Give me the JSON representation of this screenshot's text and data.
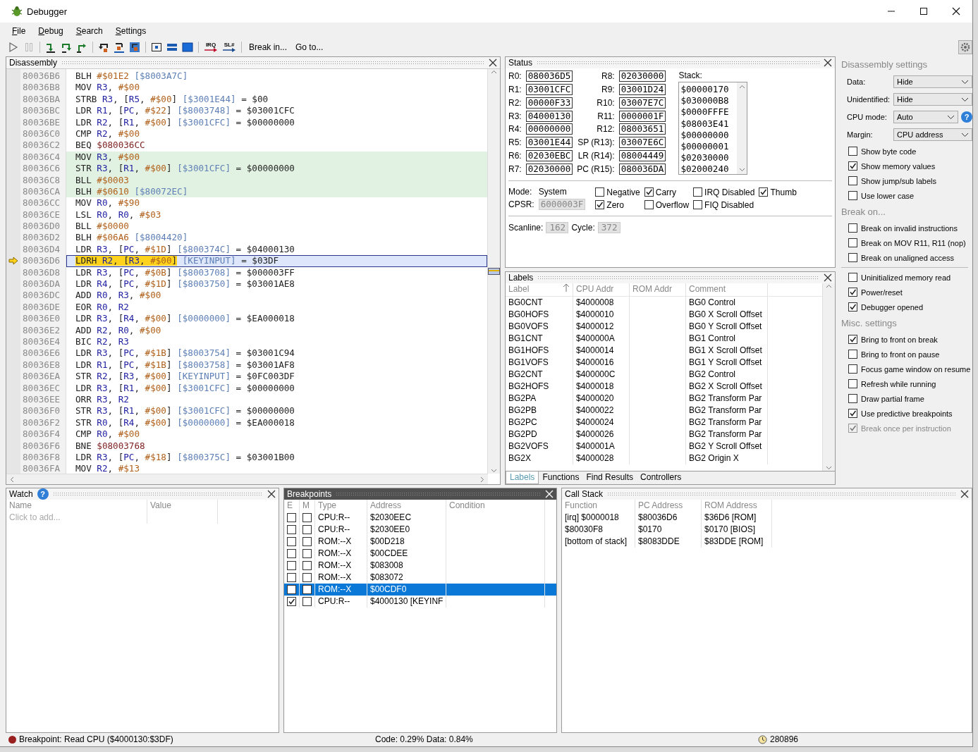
{
  "window": {
    "title": "Debugger"
  },
  "menu": [
    "File",
    "Debug",
    "Search",
    "Settings"
  ],
  "toolbar": {
    "pause_enabled": false,
    "irq_label": "IRQ",
    "scanline_label": "SL#",
    "buttons": [
      "Break in...",
      "Go to..."
    ]
  },
  "disassembly": {
    "title": "Disassembly",
    "rows": [
      {
        "address": "80036B6",
        "kind": "normal",
        "code": [
          {
            "kind": "op",
            "text": "BLH "
          },
          {
            "kind": "imm",
            "text": "#$01E2"
          }
        ],
        "note": [
          {
            "kind": "ref",
            "text": "[$8003A7C]"
          }
        ]
      },
      {
        "address": "80036B8",
        "kind": "normal",
        "code": [
          {
            "kind": "op",
            "text": "MOV "
          },
          {
            "kind": "reg",
            "text": "R3"
          },
          {
            "kind": "plain",
            "text": ", "
          },
          {
            "kind": "imm",
            "text": "#$00"
          }
        ]
      },
      {
        "address": "80036BA",
        "kind": "normal",
        "code": [
          {
            "kind": "op",
            "text": "STRB "
          },
          {
            "kind": "reg",
            "text": "R3"
          },
          {
            "kind": "plain",
            "text": ", ["
          },
          {
            "kind": "reg",
            "text": "R5"
          },
          {
            "kind": "plain",
            "text": ", "
          },
          {
            "kind": "imm",
            "text": "#$00"
          },
          {
            "kind": "plain",
            "text": "]"
          }
        ],
        "note": [
          {
            "kind": "ref",
            "text": "[$3001E44]"
          },
          {
            "kind": "plain",
            "text": " = $00"
          }
        ]
      },
      {
        "address": "80036BC",
        "kind": "normal",
        "code": [
          {
            "kind": "op",
            "text": "LDR "
          },
          {
            "kind": "reg",
            "text": "R1"
          },
          {
            "kind": "plain",
            "text": ", ["
          },
          {
            "kind": "reg",
            "text": "PC"
          },
          {
            "kind": "plain",
            "text": ", "
          },
          {
            "kind": "imm",
            "text": "#$22"
          },
          {
            "kind": "plain",
            "text": "]"
          }
        ],
        "note": [
          {
            "kind": "ref",
            "text": "[$8003748]"
          },
          {
            "kind": "plain",
            "text": " = $03001CFC"
          }
        ]
      },
      {
        "address": "80036BE",
        "kind": "normal",
        "code": [
          {
            "kind": "op",
            "text": "LDR "
          },
          {
            "kind": "reg",
            "text": "R2"
          },
          {
            "kind": "plain",
            "text": ", ["
          },
          {
            "kind": "reg",
            "text": "R1"
          },
          {
            "kind": "plain",
            "text": ", "
          },
          {
            "kind": "imm",
            "text": "#$00"
          },
          {
            "kind": "plain",
            "text": "]"
          }
        ],
        "note": [
          {
            "kind": "ref",
            "text": "[$3001CFC]"
          },
          {
            "kind": "plain",
            "text": " = $00000000"
          }
        ]
      },
      {
        "address": "80036C0",
        "kind": "normal",
        "code": [
          {
            "kind": "op",
            "text": "CMP "
          },
          {
            "kind": "reg",
            "text": "R2"
          },
          {
            "kind": "plain",
            "text": ", "
          },
          {
            "kind": "imm",
            "text": "#$00"
          }
        ]
      },
      {
        "address": "80036C2",
        "kind": "normal",
        "code": [
          {
            "kind": "op",
            "text": "BEQ "
          },
          {
            "kind": "target",
            "text": "$080036CC"
          }
        ]
      },
      {
        "address": "80036C4",
        "kind": "block",
        "code": [
          {
            "kind": "op",
            "text": "MOV "
          },
          {
            "kind": "reg",
            "text": "R3"
          },
          {
            "kind": "plain",
            "text": ", "
          },
          {
            "kind": "imm",
            "text": "#$00"
          }
        ]
      },
      {
        "address": "80036C6",
        "kind": "block",
        "code": [
          {
            "kind": "op",
            "text": "STR "
          },
          {
            "kind": "reg",
            "text": "R3"
          },
          {
            "kind": "plain",
            "text": ", ["
          },
          {
            "kind": "reg",
            "text": "R1"
          },
          {
            "kind": "plain",
            "text": ", "
          },
          {
            "kind": "imm",
            "text": "#$00"
          },
          {
            "kind": "plain",
            "text": "]"
          }
        ],
        "note": [
          {
            "kind": "ref",
            "text": "[$3001CFC]"
          },
          {
            "kind": "plain",
            "text": " = $00000000"
          }
        ]
      },
      {
        "address": "80036C8",
        "kind": "block",
        "code": [
          {
            "kind": "op",
            "text": "BLL "
          },
          {
            "kind": "imm",
            "text": "#$0003"
          }
        ]
      },
      {
        "address": "80036CA",
        "kind": "block",
        "code": [
          {
            "kind": "op",
            "text": "BLH "
          },
          {
            "kind": "imm",
            "text": "#$0610"
          }
        ],
        "note": [
          {
            "kind": "ref",
            "text": "[$80072EC]"
          }
        ]
      },
      {
        "address": "80036CC",
        "kind": "normal",
        "code": [
          {
            "kind": "op",
            "text": "MOV "
          },
          {
            "kind": "reg",
            "text": "R0"
          },
          {
            "kind": "plain",
            "text": ", "
          },
          {
            "kind": "imm",
            "text": "#$90"
          }
        ]
      },
      {
        "address": "80036CE",
        "kind": "normal",
        "code": [
          {
            "kind": "op",
            "text": "LSL "
          },
          {
            "kind": "reg",
            "text": "R0"
          },
          {
            "kind": "plain",
            "text": ", "
          },
          {
            "kind": "reg",
            "text": "R0"
          },
          {
            "kind": "plain",
            "text": ", "
          },
          {
            "kind": "imm",
            "text": "#$03"
          }
        ]
      },
      {
        "address": "80036D0",
        "kind": "normal",
        "code": [
          {
            "kind": "op",
            "text": "BLL "
          },
          {
            "kind": "imm",
            "text": "#$0000"
          }
        ]
      },
      {
        "address": "80036D2",
        "kind": "normal",
        "code": [
          {
            "kind": "op",
            "text": "BLH "
          },
          {
            "kind": "imm",
            "text": "#$06A6"
          }
        ],
        "note": [
          {
            "kind": "ref",
            "text": "[$8004420]"
          }
        ]
      },
      {
        "address": "80036D4",
        "kind": "normal",
        "code": [
          {
            "kind": "op",
            "text": "LDR "
          },
          {
            "kind": "reg",
            "text": "R3"
          },
          {
            "kind": "plain",
            "text": ", ["
          },
          {
            "kind": "reg",
            "text": "PC"
          },
          {
            "kind": "plain",
            "text": ", "
          },
          {
            "kind": "imm",
            "text": "#$1D"
          },
          {
            "kind": "plain",
            "text": "]"
          }
        ],
        "note": [
          {
            "kind": "ref",
            "text": "[$800374C]"
          },
          {
            "kind": "plain",
            "text": " = $04000130"
          }
        ]
      },
      {
        "address": "80036D6",
        "kind": "current",
        "code": [
          {
            "kind": "op",
            "text": "LDRH "
          },
          {
            "kind": "reg",
            "text": "R2"
          },
          {
            "kind": "plain",
            "text": ", ["
          },
          {
            "kind": "reg",
            "text": "R3"
          },
          {
            "kind": "plain",
            "text": ", "
          },
          {
            "kind": "imm",
            "text": "#$00"
          },
          {
            "kind": "plain",
            "text": "]"
          }
        ],
        "note": [
          {
            "kind": "ref",
            "text": "[KEYINPUT]"
          },
          {
            "kind": "plain",
            "text": " = $03DF"
          }
        ]
      },
      {
        "address": "80036D8",
        "kind": "normal",
        "code": [
          {
            "kind": "op",
            "text": "LDR "
          },
          {
            "kind": "reg",
            "text": "R3"
          },
          {
            "kind": "plain",
            "text": ", ["
          },
          {
            "kind": "reg",
            "text": "PC"
          },
          {
            "kind": "plain",
            "text": ", "
          },
          {
            "kind": "imm",
            "text": "#$0B"
          },
          {
            "kind": "plain",
            "text": "]"
          }
        ],
        "note": [
          {
            "kind": "ref",
            "text": "[$8003708]"
          },
          {
            "kind": "plain",
            "text": " = $000003FF"
          }
        ]
      },
      {
        "address": "80036DA",
        "kind": "normal",
        "code": [
          {
            "kind": "op",
            "text": "LDR "
          },
          {
            "kind": "reg",
            "text": "R4"
          },
          {
            "kind": "plain",
            "text": ", ["
          },
          {
            "kind": "reg",
            "text": "PC"
          },
          {
            "kind": "plain",
            "text": ", "
          },
          {
            "kind": "imm",
            "text": "#$1D"
          },
          {
            "kind": "plain",
            "text": "]"
          }
        ],
        "note": [
          {
            "kind": "ref",
            "text": "[$8003750]"
          },
          {
            "kind": "plain",
            "text": " = $03001AE8"
          }
        ]
      },
      {
        "address": "80036DC",
        "kind": "normal",
        "code": [
          {
            "kind": "op",
            "text": "ADD "
          },
          {
            "kind": "reg",
            "text": "R0"
          },
          {
            "kind": "plain",
            "text": ", "
          },
          {
            "kind": "reg",
            "text": "R3"
          },
          {
            "kind": "plain",
            "text": ", "
          },
          {
            "kind": "imm",
            "text": "#$00"
          }
        ]
      },
      {
        "address": "80036DE",
        "kind": "normal",
        "code": [
          {
            "kind": "op",
            "text": "EOR "
          },
          {
            "kind": "reg",
            "text": "R0"
          },
          {
            "kind": "plain",
            "text": ", "
          },
          {
            "kind": "reg",
            "text": "R2"
          }
        ]
      },
      {
        "address": "80036E0",
        "kind": "normal",
        "code": [
          {
            "kind": "op",
            "text": "LDR "
          },
          {
            "kind": "reg",
            "text": "R3"
          },
          {
            "kind": "plain",
            "text": ", ["
          },
          {
            "kind": "reg",
            "text": "R4"
          },
          {
            "kind": "plain",
            "text": ", "
          },
          {
            "kind": "imm",
            "text": "#$00"
          },
          {
            "kind": "plain",
            "text": "]"
          }
        ],
        "note": [
          {
            "kind": "ref",
            "text": "[$0000000]"
          },
          {
            "kind": "plain",
            "text": " = $EA000018"
          }
        ]
      },
      {
        "address": "80036E2",
        "kind": "normal",
        "code": [
          {
            "kind": "op",
            "text": "ADD "
          },
          {
            "kind": "reg",
            "text": "R2"
          },
          {
            "kind": "plain",
            "text": ", "
          },
          {
            "kind": "reg",
            "text": "R0"
          },
          {
            "kind": "plain",
            "text": ", "
          },
          {
            "kind": "imm",
            "text": "#$00"
          }
        ]
      },
      {
        "address": "80036E4",
        "kind": "normal",
        "code": [
          {
            "kind": "op",
            "text": "BIC "
          },
          {
            "kind": "reg",
            "text": "R2"
          },
          {
            "kind": "plain",
            "text": ", "
          },
          {
            "kind": "reg",
            "text": "R3"
          }
        ]
      },
      {
        "address": "80036E6",
        "kind": "normal",
        "code": [
          {
            "kind": "op",
            "text": "LDR "
          },
          {
            "kind": "reg",
            "text": "R3"
          },
          {
            "kind": "plain",
            "text": ", ["
          },
          {
            "kind": "reg",
            "text": "PC"
          },
          {
            "kind": "plain",
            "text": ", "
          },
          {
            "kind": "imm",
            "text": "#$1B"
          },
          {
            "kind": "plain",
            "text": "]"
          }
        ],
        "note": [
          {
            "kind": "ref",
            "text": "[$8003754]"
          },
          {
            "kind": "plain",
            "text": " = $03001C94"
          }
        ]
      },
      {
        "address": "80036E8",
        "kind": "normal",
        "code": [
          {
            "kind": "op",
            "text": "LDR "
          },
          {
            "kind": "reg",
            "text": "R1"
          },
          {
            "kind": "plain",
            "text": ", ["
          },
          {
            "kind": "reg",
            "text": "PC"
          },
          {
            "kind": "plain",
            "text": ", "
          },
          {
            "kind": "imm",
            "text": "#$1B"
          },
          {
            "kind": "plain",
            "text": "]"
          }
        ],
        "note": [
          {
            "kind": "ref",
            "text": "[$8003758]"
          },
          {
            "kind": "plain",
            "text": " = $03001AF8"
          }
        ]
      },
      {
        "address": "80036EA",
        "kind": "normal",
        "code": [
          {
            "kind": "op",
            "text": "STR "
          },
          {
            "kind": "reg",
            "text": "R2"
          },
          {
            "kind": "plain",
            "text": ", ["
          },
          {
            "kind": "reg",
            "text": "R3"
          },
          {
            "kind": "plain",
            "text": ", "
          },
          {
            "kind": "imm",
            "text": "#$00"
          },
          {
            "kind": "plain",
            "text": "]"
          }
        ],
        "note": [
          {
            "kind": "ref",
            "text": "[KEYINPUT]"
          },
          {
            "kind": "plain",
            "text": " = $0FC003DF"
          }
        ]
      },
      {
        "address": "80036EC",
        "kind": "normal",
        "code": [
          {
            "kind": "op",
            "text": "LDR "
          },
          {
            "kind": "reg",
            "text": "R3"
          },
          {
            "kind": "plain",
            "text": ", ["
          },
          {
            "kind": "reg",
            "text": "R1"
          },
          {
            "kind": "plain",
            "text": ", "
          },
          {
            "kind": "imm",
            "text": "#$00"
          },
          {
            "kind": "plain",
            "text": "]"
          }
        ],
        "note": [
          {
            "kind": "ref",
            "text": "[$3001CFC]"
          },
          {
            "kind": "plain",
            "text": " = $00000000"
          }
        ]
      },
      {
        "address": "80036EE",
        "kind": "normal",
        "code": [
          {
            "kind": "op",
            "text": "ORR "
          },
          {
            "kind": "reg",
            "text": "R3"
          },
          {
            "kind": "plain",
            "text": ", "
          },
          {
            "kind": "reg",
            "text": "R2"
          }
        ]
      },
      {
        "address": "80036F0",
        "kind": "normal",
        "code": [
          {
            "kind": "op",
            "text": "STR "
          },
          {
            "kind": "reg",
            "text": "R3"
          },
          {
            "kind": "plain",
            "text": ", ["
          },
          {
            "kind": "reg",
            "text": "R1"
          },
          {
            "kind": "plain",
            "text": ", "
          },
          {
            "kind": "imm",
            "text": "#$00"
          },
          {
            "kind": "plain",
            "text": "]"
          }
        ],
        "note": [
          {
            "kind": "ref",
            "text": "[$3001CFC]"
          },
          {
            "kind": "plain",
            "text": " = $00000000"
          }
        ]
      },
      {
        "address": "80036F2",
        "kind": "normal",
        "code": [
          {
            "kind": "op",
            "text": "STR "
          },
          {
            "kind": "reg",
            "text": "R0"
          },
          {
            "kind": "plain",
            "text": ", ["
          },
          {
            "kind": "reg",
            "text": "R4"
          },
          {
            "kind": "plain",
            "text": ", "
          },
          {
            "kind": "imm",
            "text": "#$00"
          },
          {
            "kind": "plain",
            "text": "]"
          }
        ],
        "note": [
          {
            "kind": "ref",
            "text": "[$0000000]"
          },
          {
            "kind": "plain",
            "text": " = $EA000018"
          }
        ]
      },
      {
        "address": "80036F4",
        "kind": "normal",
        "code": [
          {
            "kind": "op",
            "text": "CMP "
          },
          {
            "kind": "reg",
            "text": "R0"
          },
          {
            "kind": "plain",
            "text": ", "
          },
          {
            "kind": "imm",
            "text": "#$00"
          }
        ]
      },
      {
        "address": "80036F6",
        "kind": "normal",
        "code": [
          {
            "kind": "op",
            "text": "BNE "
          },
          {
            "kind": "target",
            "text": "$08003768"
          }
        ]
      },
      {
        "address": "80036F8",
        "kind": "normal",
        "code": [
          {
            "kind": "op",
            "text": "LDR "
          },
          {
            "kind": "reg",
            "text": "R3"
          },
          {
            "kind": "plain",
            "text": ", ["
          },
          {
            "kind": "reg",
            "text": "PC"
          },
          {
            "kind": "plain",
            "text": ", "
          },
          {
            "kind": "imm",
            "text": "#$18"
          },
          {
            "kind": "plain",
            "text": "]"
          }
        ],
        "note": [
          {
            "kind": "ref",
            "text": "[$800375C]"
          },
          {
            "kind": "plain",
            "text": " = $03001B00"
          }
        ]
      },
      {
        "address": "80036FA",
        "kind": "normal",
        "code": [
          {
            "kind": "op",
            "text": "MOV "
          },
          {
            "kind": "reg",
            "text": "R2"
          },
          {
            "kind": "plain",
            "text": ", "
          },
          {
            "kind": "imm",
            "text": "#$13"
          }
        ]
      }
    ]
  },
  "status": {
    "title": "Status",
    "registers": [
      {
        "name": "R0:",
        "value": "080036D5"
      },
      {
        "name": "R8:",
        "value": "02030000"
      },
      {
        "name": "R1:",
        "value": "03001CFC"
      },
      {
        "name": "R9:",
        "value": "03001D24"
      },
      {
        "name": "R2:",
        "value": "00000F33"
      },
      {
        "name": "R10:",
        "value": "03007E7C"
      },
      {
        "name": "R3:",
        "value": "04000130"
      },
      {
        "name": "R11:",
        "value": "0000001F"
      },
      {
        "name": "R4:",
        "value": "00000000"
      },
      {
        "name": "R12:",
        "value": "08003651"
      },
      {
        "name": "R5:",
        "value": "03001E44"
      },
      {
        "name": "SP (R13):",
        "value": "03007E6C"
      },
      {
        "name": "R6:",
        "value": "02030EBC"
      },
      {
        "name": "LR (R14):",
        "value": "08004449"
      },
      {
        "name": "R7:",
        "value": "02030000"
      },
      {
        "name": "PC (R15):",
        "value": "080036DA"
      }
    ],
    "stack_label": "Stack:",
    "stack": [
      "$00000170",
      "$030000B8",
      "$0000FFFE",
      "$08003E41",
      "$00000000",
      "$00000001",
      "$02030000",
      "$02000240"
    ],
    "mode_label": "Mode:",
    "mode": "System",
    "cpsr_label": "CPSR:",
    "cpsr": "6000003F",
    "flags": [
      {
        "label": "Negative",
        "checked": false
      },
      {
        "label": "Carry",
        "checked": true
      },
      {
        "label": "IRQ Disabled",
        "checked": false
      },
      {
        "label": "Thumb",
        "checked": true
      },
      {
        "label": "Zero",
        "checked": true
      },
      {
        "label": "Overflow",
        "checked": false
      },
      {
        "label": "FIQ Disabled",
        "checked": false
      }
    ],
    "scanline_label": "Scanline:",
    "scanline": "162",
    "cycle_label": "Cycle:",
    "cycle": "372"
  },
  "labels": {
    "title": "Labels",
    "columns": [
      {
        "label": "Label",
        "sorted": true
      },
      {
        "label": "CPU Addr",
        "sorted": false
      },
      {
        "label": "ROM Addr",
        "sorted": false
      },
      {
        "label": "Comment",
        "sorted": false
      }
    ],
    "rows": [
      {
        "label": "BG0CNT",
        "cpu_addr": "$4000008",
        "comment": "BG0 Control"
      },
      {
        "label": "BG0HOFS",
        "cpu_addr": "$4000010",
        "comment": "BG0 X Scroll Offset"
      },
      {
        "label": "BG0VOFS",
        "cpu_addr": "$4000012",
        "comment": "BG0 Y Scroll Offset"
      },
      {
        "label": "BG1CNT",
        "cpu_addr": "$400000A",
        "comment": "BG1 Control"
      },
      {
        "label": "BG1HOFS",
        "cpu_addr": "$4000014",
        "comment": "BG1 X Scroll Offset"
      },
      {
        "label": "BG1VOFS",
        "cpu_addr": "$4000016",
        "comment": "BG1 Y Scroll Offset"
      },
      {
        "label": "BG2CNT",
        "cpu_addr": "$400000C",
        "comment": "BG2 Control"
      },
      {
        "label": "BG2HOFS",
        "cpu_addr": "$4000018",
        "comment": "BG2 X Scroll Offset"
      },
      {
        "label": "BG2PA",
        "cpu_addr": "$4000020",
        "comment": "BG2 Transform Par"
      },
      {
        "label": "BG2PB",
        "cpu_addr": "$4000022",
        "comment": "BG2 Transform Par"
      },
      {
        "label": "BG2PC",
        "cpu_addr": "$4000024",
        "comment": "BG2 Transform Par"
      },
      {
        "label": "BG2PD",
        "cpu_addr": "$4000026",
        "comment": "BG2 Transform Par"
      },
      {
        "label": "BG2VOFS",
        "cpu_addr": "$400001A",
        "comment": "BG2 Y Scroll Offset"
      },
      {
        "label": "BG2X",
        "cpu_addr": "$4000028",
        "comment": "BG2 Origin X"
      }
    ],
    "tabs": [
      {
        "label": "Labels",
        "selected": true
      },
      {
        "label": "Functions",
        "selected": false
      },
      {
        "label": "Find Results",
        "selected": false
      },
      {
        "label": "Controllers",
        "selected": false
      }
    ]
  },
  "settings": {
    "title": "Disassembly settings",
    "fields": [
      {
        "label": "Data:",
        "value": "Hide"
      },
      {
        "label": "Unidentified:",
        "value": "Hide"
      },
      {
        "label": "CPU mode:",
        "value": "Auto",
        "help": "?"
      },
      {
        "label": "Margin:",
        "value": "CPU address"
      }
    ],
    "options": [
      {
        "label": "Show byte code",
        "checked": false
      },
      {
        "label": "Show memory values",
        "checked": true
      },
      {
        "label": "Show jump/sub labels",
        "checked": false
      },
      {
        "label": "Use lower case",
        "checked": false
      }
    ],
    "break_title": "Break on...",
    "break_options": [
      {
        "label": "Break on invalid instructions",
        "checked": false
      },
      {
        "label": "Break on MOV R11, R11 (nop)",
        "checked": false
      },
      {
        "label": "Break on unaligned access",
        "checked": false
      }
    ],
    "break_events": [
      {
        "label": "Uninitialized memory read",
        "checked": false
      },
      {
        "label": "Power/reset",
        "checked": true
      },
      {
        "label": "Debugger opened",
        "checked": true
      }
    ],
    "misc_title": "Misc. settings",
    "misc_options": [
      {
        "label": "Bring to front on break",
        "checked": true,
        "disabled": false
      },
      {
        "label": "Bring to front on pause",
        "checked": false,
        "disabled": false
      },
      {
        "label": "Focus game window on resume",
        "checked": false,
        "disabled": false
      },
      {
        "label": "Refresh while running",
        "checked": false,
        "disabled": false
      },
      {
        "label": "Draw partial frame",
        "checked": false,
        "disabled": false
      },
      {
        "label": "Use predictive breakpoints",
        "checked": true,
        "disabled": false
      },
      {
        "label": "Break once per instruction",
        "checked": true,
        "disabled": true
      }
    ]
  },
  "watch": {
    "title": "Watch",
    "help": "?",
    "columns": [
      "Name",
      "Value"
    ],
    "placeholder": "Click to add..."
  },
  "breakpoints": {
    "title": "Breakpoints",
    "active": true,
    "columns": [
      "E",
      "M",
      "Type",
      "Address",
      "Condition"
    ],
    "rows": [
      {
        "enabled": false,
        "marked": false,
        "type": "CPU:R--",
        "address": "$2030EEC",
        "selected": false
      },
      {
        "enabled": false,
        "marked": false,
        "type": "CPU:R--",
        "address": "$2030EE0",
        "selected": false
      },
      {
        "enabled": false,
        "marked": false,
        "type": "ROM:--X",
        "address": "$00D218",
        "selected": false
      },
      {
        "enabled": false,
        "marked": false,
        "type": "ROM:--X",
        "address": "$00CDEE",
        "selected": false
      },
      {
        "enabled": false,
        "marked": false,
        "type": "ROM:--X",
        "address": "$083008",
        "selected": false
      },
      {
        "enabled": false,
        "marked": false,
        "type": "ROM:--X",
        "address": "$083072",
        "selected": false
      },
      {
        "enabled": false,
        "marked": false,
        "type": "ROM:--X",
        "address": "$00CDF0",
        "selected": true
      },
      {
        "enabled": true,
        "marked": false,
        "type": "CPU:R--",
        "address": "$4000130 [KEYINF",
        "selected": false
      }
    ]
  },
  "call_stack": {
    "title": "Call Stack",
    "columns": [
      "Function",
      "PC Address",
      "ROM Address"
    ],
    "rows": [
      [
        "[irq] $0000018",
        "$80036D6",
        "$36D6 [ROM]"
      ],
      [
        "$80030F8",
        "$0170",
        "$0170 [BIOS]"
      ],
      [
        "[bottom of stack]",
        "$8083DDE",
        "$83DDE [ROM]"
      ]
    ]
  },
  "status_bar": {
    "message": "Breakpoint: Read CPU ($4000130:$3DF)",
    "usage": "Code: 0.29% Data: 0.84%",
    "cycles": "280896"
  }
}
